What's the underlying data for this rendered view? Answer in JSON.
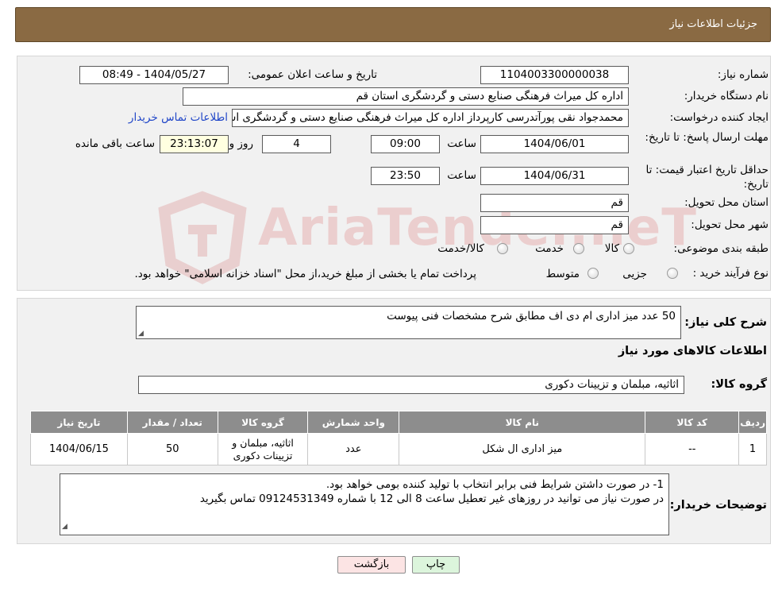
{
  "header": {
    "title": "جزئیات اطلاعات نیاز"
  },
  "labels": {
    "need_number": "شماره نیاز:",
    "announce_datetime": "تاریخ و ساعت اعلان عمومی:",
    "buyer_org": "نام دستگاه خریدار:",
    "requester": "ایجاد کننده درخواست:",
    "reply_deadline": "مهلت ارسال پاسخ: تا تاریخ:",
    "time": "ساعت",
    "day_and": "روز و",
    "time_remaining": "ساعت باقی مانده",
    "price_validity": "حداقل تاریخ اعتبار قیمت: تا تاریخ:",
    "delivery_province": "استان محل تحویل:",
    "delivery_city": "شهر محل تحویل:",
    "category": "طبقه بندی موضوعی:",
    "purchase_type": "نوع فرآیند خرید :"
  },
  "values": {
    "need_number": "1104003300000038",
    "announce_datetime": "1404/05/27 - 08:49",
    "buyer_org": "اداره کل میراث فرهنگی  صنایع دستی و گردشگری استان قم",
    "requester": "محمدجواد نقی پورآتدرسی کارپرداز اداره کل میراث فرهنگی  صنایع دستی و گردشگری استان قم",
    "buyer_contact_link": "اطلاعات تماس خریدار",
    "reply_date": "1404/06/01",
    "reply_time": "09:00",
    "days": "4",
    "remaining_time": "23:13:07",
    "validity_date": "1404/06/31",
    "validity_time": "23:50",
    "province": "قم",
    "city": "قم"
  },
  "category_options": [
    "کالا",
    "خدمت",
    "کالا/خدمت"
  ],
  "purchase_options": [
    "جزیی",
    "متوسط"
  ],
  "purchase_note": "پرداخت تمام یا بخشی از مبلغ خرید،از محل \"اسناد خزانه اسلامی\" خواهد بود.",
  "summary": {
    "label": "شرح کلی نیاز:",
    "text": "50 عدد میز اداری ام دی اف مطابق شرح مشخصات فنی پیوست"
  },
  "goods_info": {
    "title": "اطلاعات کالاهای مورد نیاز",
    "group_label": "گروه کالا:",
    "group_value": "اثاثیه، مبلمان و تزیینات دکوری"
  },
  "table": {
    "headers": [
      "ردیف",
      "کد کالا",
      "نام کالا",
      "واحد شمارش",
      "گروه کالا",
      "تعداد / مقدار",
      "تاریخ نیاز"
    ],
    "rows": [
      [
        "1",
        "--",
        "میز اداری ال شکل",
        "عدد",
        "اثاثیه، مبلمان و تزیینات دکوری",
        "50",
        "1404/06/15"
      ]
    ]
  },
  "buyer_notes": {
    "label": "توضیحات خریدار:",
    "line1": "1- در صورت داشتن شرایط فنی برابر انتخاب با تولید کننده بومی خواهد بود.",
    "line2": "در صورت نیاز می توانید در روزهای غیر تعطیل ساعت 8 الی 12 با شماره 09124531349 تماس بگیرید"
  },
  "buttons": {
    "print": "چاپ",
    "back": "بازگشت"
  },
  "watermark": "AriaTender.neT",
  "colors": {
    "header_bg": "#8a6a43",
    "link": "#2046c8",
    "table_header": "#8d8d8d",
    "print_bg": "#dcf5dc",
    "back_bg": "#fce4e4"
  }
}
